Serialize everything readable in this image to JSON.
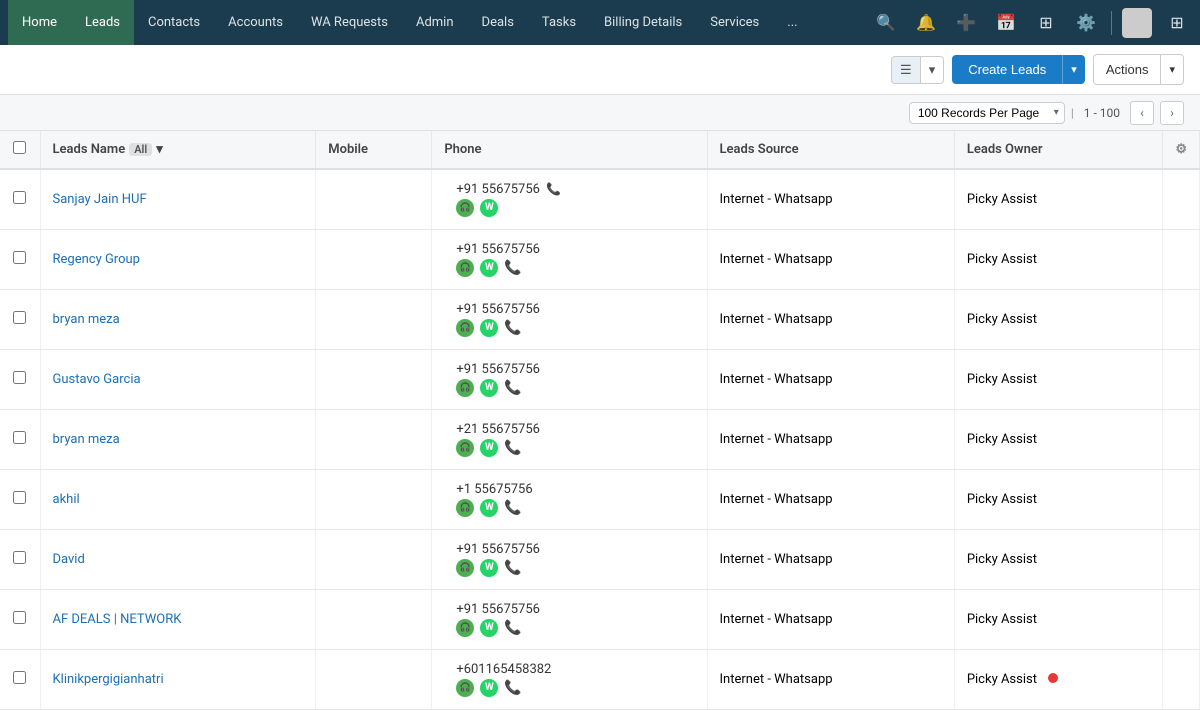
{
  "navbar": {
    "items": [
      {
        "label": "Home",
        "active": false,
        "home": true
      },
      {
        "label": "Leads",
        "active": true
      },
      {
        "label": "Contacts",
        "active": false
      },
      {
        "label": "Accounts",
        "active": false
      },
      {
        "label": "WA Requests",
        "active": false
      },
      {
        "label": "Admin",
        "active": false
      },
      {
        "label": "Deals",
        "active": false
      },
      {
        "label": "Tasks",
        "active": false
      },
      {
        "label": "Billing Details",
        "active": false
      },
      {
        "label": "Services",
        "active": false
      },
      {
        "label": "...",
        "active": false
      }
    ]
  },
  "toolbar": {
    "create_label": "Create Leads",
    "actions_label": "Actions"
  },
  "pagination": {
    "per_page": "100 Records Per Page",
    "range": "1 - 100"
  },
  "table": {
    "columns": [
      {
        "label": "Leads Name",
        "filter": "All"
      },
      {
        "label": "Mobile"
      },
      {
        "label": "Phone"
      },
      {
        "label": "Leads Source"
      },
      {
        "label": "Leads Owner"
      }
    ],
    "rows": [
      {
        "name": "Sanjay Jain HUF",
        "mobile": "",
        "phone": "+91 55675756",
        "phone2": "",
        "source": "Internet - Whatsapp",
        "owner": "Picky Assist"
      },
      {
        "name": "Regency Group",
        "mobile": "",
        "phone": "+91 55675756",
        "phone2": "",
        "source": "Internet - Whatsapp",
        "owner": "Picky Assist"
      },
      {
        "name": "bryan meza",
        "mobile": "",
        "phone": "+91 55675756",
        "phone2": "",
        "source": "Internet - Whatsapp",
        "owner": "Picky Assist"
      },
      {
        "name": "Gustavo Garcia",
        "mobile": "",
        "phone": "+91 55675756",
        "phone2": "",
        "source": "Internet - Whatsapp",
        "owner": "Picky Assist"
      },
      {
        "name": "bryan meza",
        "mobile": "",
        "phone": "+21 55675756",
        "phone2": "",
        "source": "Internet - Whatsapp",
        "owner": "Picky Assist"
      },
      {
        "name": "akhil",
        "mobile": "",
        "phone": "+1 55675756",
        "phone2": "",
        "source": "Internet - Whatsapp",
        "owner": "Picky Assist"
      },
      {
        "name": "David",
        "mobile": "",
        "phone": "+91 55675756",
        "phone2": "",
        "source": "Internet - Whatsapp",
        "owner": "Picky Assist"
      },
      {
        "name": "AF DEALS | NETWORK",
        "mobile": "",
        "phone": "+91 55675756",
        "phone2": "",
        "source": "Internet - Whatsapp",
        "owner": "Picky Assist"
      },
      {
        "name": "Klinikpergigianhatri",
        "mobile": "",
        "phone": "+601165458382",
        "phone2": "",
        "source": "Internet - Whatsapp",
        "owner": "Picky Assist"
      }
    ]
  }
}
